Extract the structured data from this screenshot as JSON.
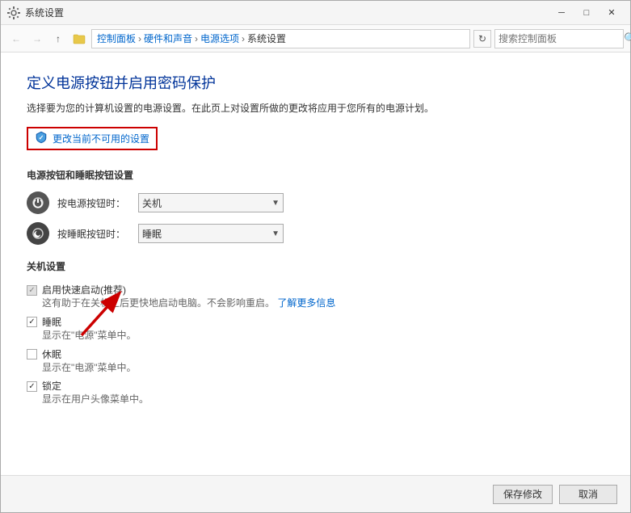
{
  "window": {
    "title": "系统设置",
    "minimize_label": "─",
    "maximize_label": "□",
    "close_label": "✕"
  },
  "addressbar": {
    "back_label": "←",
    "forward_label": "→",
    "up_label": "↑",
    "breadcrumbs": [
      {
        "label": "控制面板",
        "sep": " > "
      },
      {
        "label": "硬件和声音",
        "sep": " > "
      },
      {
        "label": "电源选项",
        "sep": " > "
      },
      {
        "label": "系统设置",
        "sep": ""
      }
    ],
    "refresh_label": "↻",
    "search_placeholder": "搜索控制面板"
  },
  "page": {
    "title": "定义电源按钮并启用密码保护",
    "description": "选择要为您的计算机设置的电源设置。在此页上对设置所做的更改将应用于您所有的电源计划。",
    "change_settings_label": "更改当前不可用的设置",
    "power_btn_section": "电源按钮和睡眠按钮设置",
    "power_btn_label": "按电源按钮时：",
    "power_btn_value": "关机",
    "sleep_btn_label": "按睡眠按钮时：",
    "sleep_btn_value": "睡眠",
    "shutdown_section": "关机设置",
    "fast_startup_label": "启用快速启动(推荐)",
    "fast_startup_desc": "这有助于在关机之后更快地启动电脑。不会影响重启。",
    "learn_more_label": "了解更多信息",
    "sleep_label": "睡眠",
    "sleep_desc": "显示在\"电源\"菜单中。",
    "hibernate_label": "休眠",
    "hibernate_desc": "显示在\"电源\"菜单中。",
    "lock_label": "锁定",
    "lock_desc": "显示在用户头像菜单中。"
  },
  "footer": {
    "save_label": "保存修改",
    "cancel_label": "取消"
  }
}
